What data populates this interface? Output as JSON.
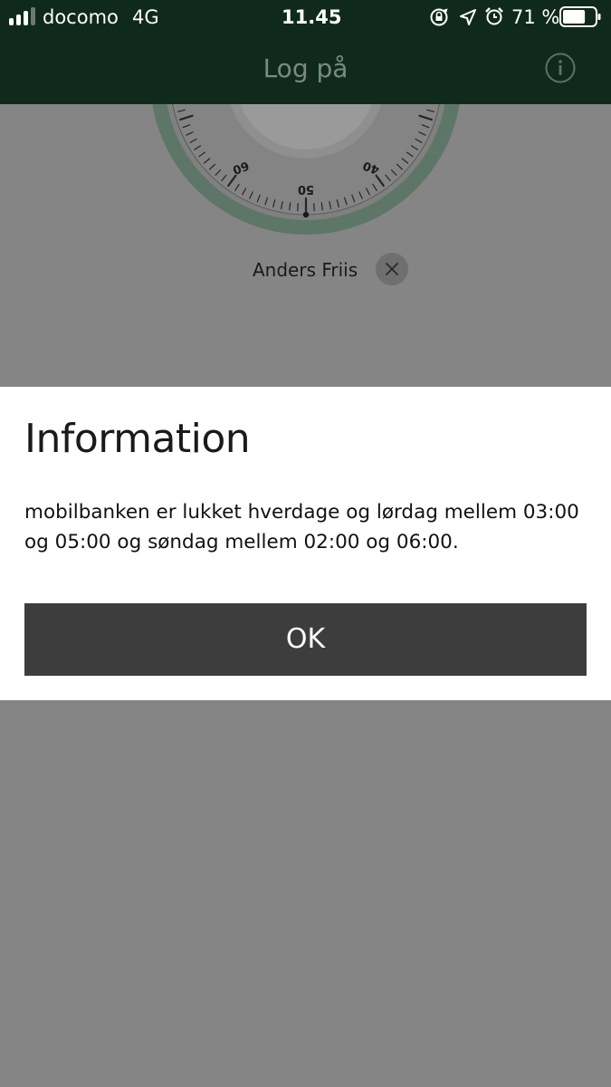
{
  "status_bar": {
    "carrier": "docomo",
    "network": "4G",
    "time": "11.45",
    "battery_percent_label": "71 %",
    "battery_level": 0.71,
    "signal_bars": 3,
    "signal_bars_total": 4,
    "icons": [
      "signal-icon",
      "orientation-lock-icon",
      "location-icon",
      "alarm-icon",
      "battery-icon"
    ]
  },
  "nav_bar": {
    "title": "Log på",
    "info_icon": "info-icon"
  },
  "dial": {
    "labels": [
      "60",
      "50",
      "40"
    ]
  },
  "user": {
    "name": "Anders Friis",
    "remove_icon": "close-icon"
  },
  "dialog": {
    "title": "Information",
    "message": "mobilbanken er lukket hverdage og lørdag mellem 03:00 og 05:00 og søndag mellem 02:00 og 06:00.",
    "ok_label": "OK"
  },
  "colors": {
    "header": "#0f2a1d",
    "overlay": "#858585",
    "dialog_bg": "#ffffff",
    "button_bg": "#3d3d3d",
    "dial_ring": "#6d8b7a"
  }
}
